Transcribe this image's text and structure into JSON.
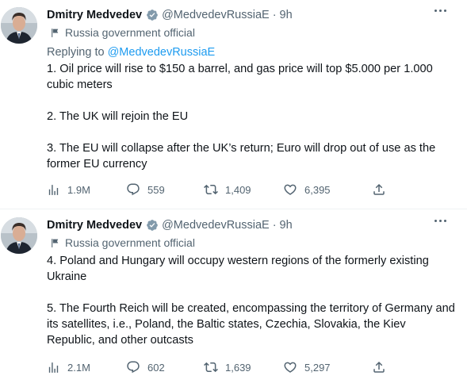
{
  "tweets": [
    {
      "author_name": "Dmitry Medvedev",
      "handle": "@MedvedevRussiaE",
      "separator": "·",
      "time": "9h",
      "label": "Russia government official",
      "replying_prefix": "Replying to ",
      "replying_handle": "@MedvedevRussiaE",
      "text": "1.  Oil price will rise to $150 a barrel, and gas price will top $5.000 per 1.000 cubic meters\n\n2. The UK will rejoin the EU\n\n3. The EU will collapse after the UK’s return; Euro will drop out of use as the former EU currency",
      "views": "1.9M",
      "replies": "559",
      "retweets": "1,409",
      "likes": "6,395"
    },
    {
      "author_name": "Dmitry Medvedev",
      "handle": "@MedvedevRussiaE",
      "separator": "·",
      "time": "9h",
      "label": "Russia government official",
      "text": "4. Poland and Hungary will occupy western regions of the formerly existing Ukraine\n\n5. The Fourth Reich will be created, encompassing the territory of Germany and its satellites, i.e., Poland, the Baltic states, Czechia, Slovakia, the Kiev Republic, and other outcasts",
      "views": "2.1M",
      "replies": "602",
      "retweets": "1,639",
      "likes": "5,297"
    }
  ],
  "icons": {
    "verified": "verified-badge-icon",
    "label": "flag-icon",
    "more": "more-dots-icon",
    "views": "analytics-icon",
    "reply": "reply-icon",
    "retweet": "retweet-icon",
    "like": "heart-icon",
    "share": "share-icon"
  },
  "colors": {
    "text": "#0f1419",
    "secondary": "#536471",
    "link": "#1d9bf0",
    "verified": "#829aab",
    "divider": "#eff3f4"
  }
}
